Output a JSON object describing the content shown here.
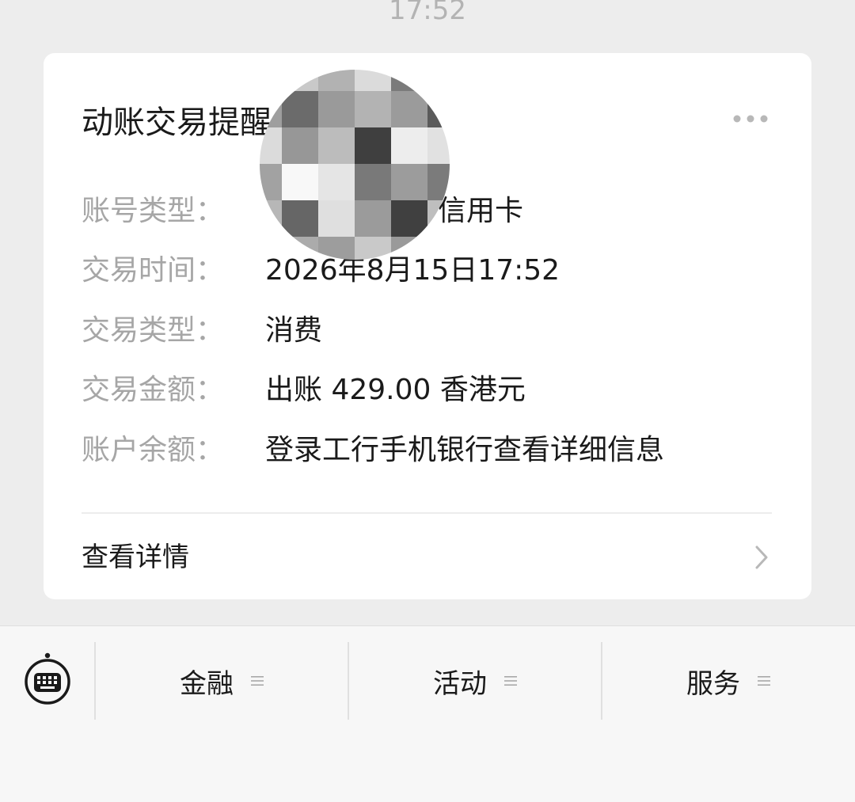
{
  "chat": {
    "timestamp": "17:52"
  },
  "card": {
    "title": "动账交易提醒",
    "more_icon": "more-icon",
    "rows": [
      {
        "label": "账号类型：",
        "value": "信用卡"
      },
      {
        "label": "交易时间：",
        "value": "2026年8月15日17:52"
      },
      {
        "label": "交易类型：",
        "value": "消费"
      },
      {
        "label": "交易金额：",
        "value": "出账 429.00 香港元"
      },
      {
        "label": "账户余额：",
        "value": "登录工行手机银行查看详细信息"
      }
    ],
    "details_link": {
      "label": "查看详情",
      "icon": "chevron-right-icon"
    }
  },
  "bottom_menu": {
    "keyboard_icon": "keyboard-icon",
    "items": [
      {
        "label": "金融",
        "icon": "menu-lines-icon"
      },
      {
        "label": "活动",
        "icon": "menu-lines-icon"
      },
      {
        "label": "服务",
        "icon": "menu-lines-icon"
      }
    ]
  },
  "colors": {
    "page_background": "#ededed",
    "card_background": "#ffffff",
    "label_text": "#a6a6a6",
    "value_text": "#1a1a1a",
    "muted_text": "#b3b3b3",
    "menu_background": "#f7f7f7"
  }
}
